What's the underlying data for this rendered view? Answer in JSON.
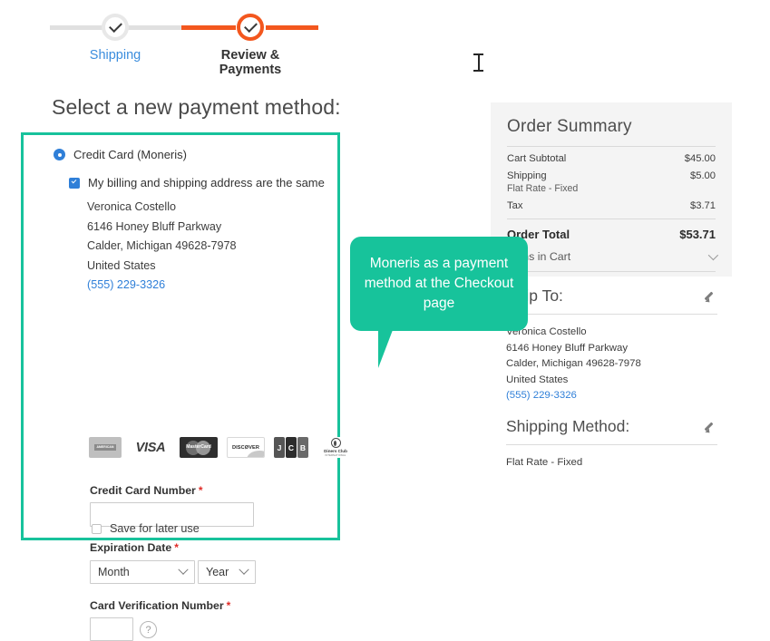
{
  "progress": {
    "steps": [
      {
        "label": "Shipping",
        "state": "done"
      },
      {
        "label": "Review & Payments",
        "state": "current"
      }
    ],
    "active_color": "#f3571e",
    "done_color": "#e8e8e8",
    "link_color": "#3b8ddd"
  },
  "payment": {
    "heading": "Select a new payment method:",
    "box_border_color": "#18c29c",
    "method_label": "Credit Card (Moneris)",
    "same_address_label": "My billing and shipping address are the same",
    "billing_address": {
      "name": "Veronica Costello",
      "street": "6146 Honey Bluff Parkway",
      "city_state_zip": "Calder, Michigan 49628-7978",
      "country": "United States",
      "phone": "(555) 229-3326"
    },
    "accepted_cards": [
      "american-express",
      "visa",
      "mastercard",
      "discover",
      "jcb",
      "diners-club"
    ],
    "card_logo_text": {
      "amex_line1": "AMERICAN",
      "amex_line2": "EXPRESS",
      "visa": "VISA",
      "mastercard": "MasterCard",
      "discover": "DISCØVER",
      "jcb_j": "J",
      "jcb_c": "C",
      "jcb_b": "B",
      "diners_line1": "Diners Club",
      "diners_line2": "INTERNATIONAL"
    },
    "fields": {
      "card_number_label": "Credit Card Number",
      "card_number_value": "",
      "expiration_label": "Expiration Date",
      "month_value": "Month",
      "year_value": "Year",
      "cvn_label": "Card Verification Number",
      "cvn_value": "",
      "help_glyph": "?",
      "required_marker": "*"
    },
    "save_for_later_label": "Save for later use",
    "save_for_later_checked": false
  },
  "order_summary": {
    "title": "Order Summary",
    "rows": [
      {
        "label": "Cart Subtotal",
        "sublabel": "",
        "value": "$45.00"
      },
      {
        "label": "Shipping",
        "sublabel": "Flat Rate - Fixed",
        "value": "$5.00"
      },
      {
        "label": "Tax",
        "sublabel": "",
        "value": "$3.71"
      }
    ],
    "total_label": "Order Total",
    "total_value": "$53.71",
    "cart_toggle_label": "Items in Cart"
  },
  "ship_to": {
    "title": "Ship To:",
    "edit_icon": "pencil-icon",
    "name": "Veronica Costello",
    "street": "6146 Honey Bluff Parkway",
    "city_state_zip": "Calder, Michigan 49628-7978",
    "country": "United States",
    "phone": "(555) 229-3326"
  },
  "shipping_method": {
    "title": "Shipping Method:",
    "edit_icon": "pencil-icon",
    "value": "Flat Rate - Fixed"
  },
  "callout": {
    "text": "Moneris as a payment method at the Checkout page",
    "color": "#17c39b"
  }
}
